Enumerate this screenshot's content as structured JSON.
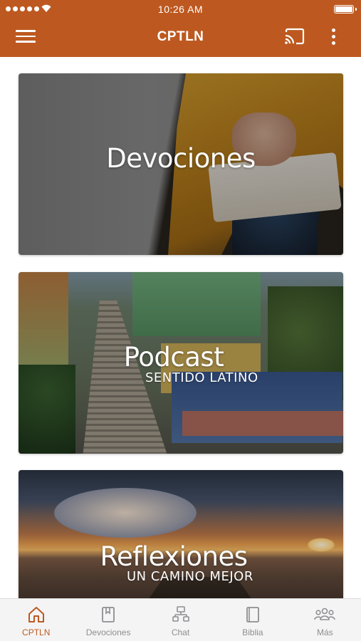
{
  "status_bar": {
    "time": "10:26 AM"
  },
  "app_bar": {
    "title": "CPTLN"
  },
  "cards": [
    {
      "title": "Devociones",
      "subtitle": ""
    },
    {
      "title": "Podcast",
      "subtitle": "SENTIDO LATINO"
    },
    {
      "title": "Reflexiones",
      "subtitle": "UN CAMINO MEJOR"
    }
  ],
  "tabs": [
    {
      "label": "CPTLN",
      "icon": "home-icon",
      "active": true
    },
    {
      "label": "Devociones",
      "icon": "book-bookmark-icon",
      "active": false
    },
    {
      "label": "Chat",
      "icon": "chat-network-icon",
      "active": false
    },
    {
      "label": "Biblia",
      "icon": "bible-icon",
      "active": false
    },
    {
      "label": "Más",
      "icon": "people-group-icon",
      "active": false
    }
  ],
  "colors": {
    "brand": "#bd5920",
    "tab_inactive": "#8e8e93",
    "tab_bar_bg": "#f4f4f4"
  }
}
